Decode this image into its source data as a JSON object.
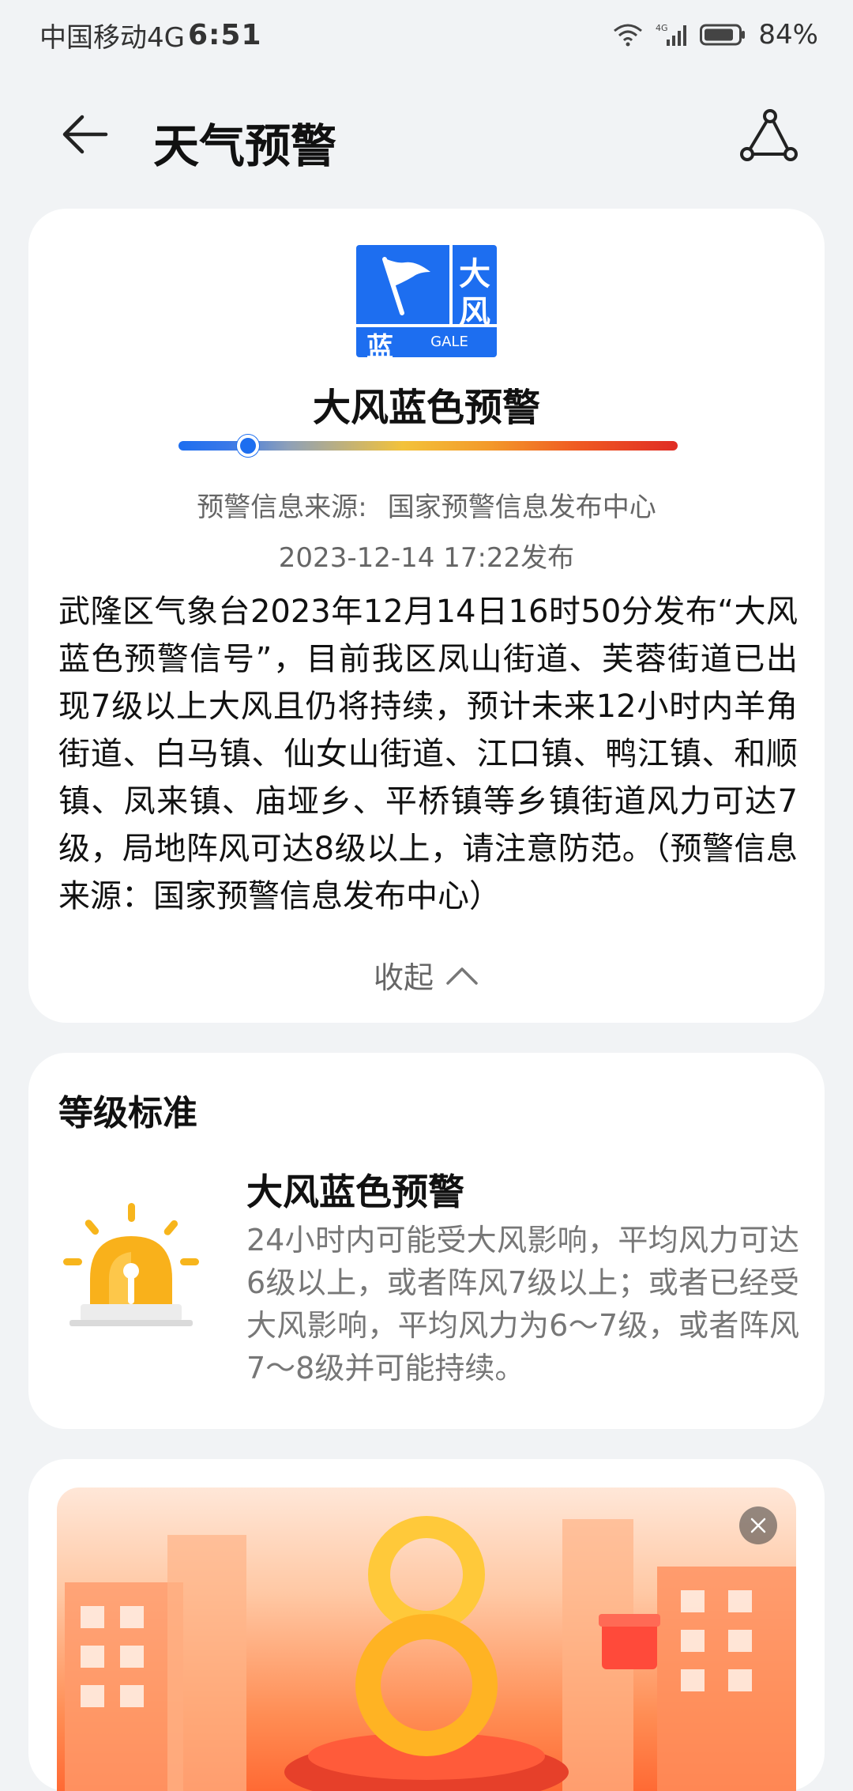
{
  "status_bar": {
    "carrier": "中国移动4G",
    "time": "6:51",
    "network": "4G",
    "battery": "84%"
  },
  "header": {
    "title": "天气预警"
  },
  "alert": {
    "icon": {
      "char_top": "大",
      "char_mid": "风",
      "char_bottom": "蓝",
      "sub_label": "GALE",
      "color": "#1d6ef0"
    },
    "title": "大风蓝色预警",
    "level_fraction": 0.14,
    "source_label": "预警信息来源:",
    "source_value": "国家预警信息发布中心",
    "publish_time": "2023-12-14 17:22发布",
    "body": "武隆区气象台2023年12月14日16时50分发布“大风蓝色预警信号”，目前我区凤山街道、芙蓉街道已出现7级以上大风且仍将持续，预计未来12小时内羊角街道、白马镇、仙女山街道、江口镇、鸭江镇、和顺镇、凤来镇、庙垭乡、平桥镇等乡镇街道风力可达7级，局地阵风可达8级以上，请注意防范。（预警信息来源：国家预警信息发布中心）",
    "collapse_label": "收起"
  },
  "level_standard": {
    "heading": "等级标准",
    "name": "大风蓝色预警",
    "description": "24小时内可能受大风影响，平均风力可达6级以上，或者阵风7级以上；或者已经受大风影响，平均风力为6～7级，或者阵风7～8级并可能持续。"
  },
  "ad": {
    "close_icon": "close-icon"
  }
}
